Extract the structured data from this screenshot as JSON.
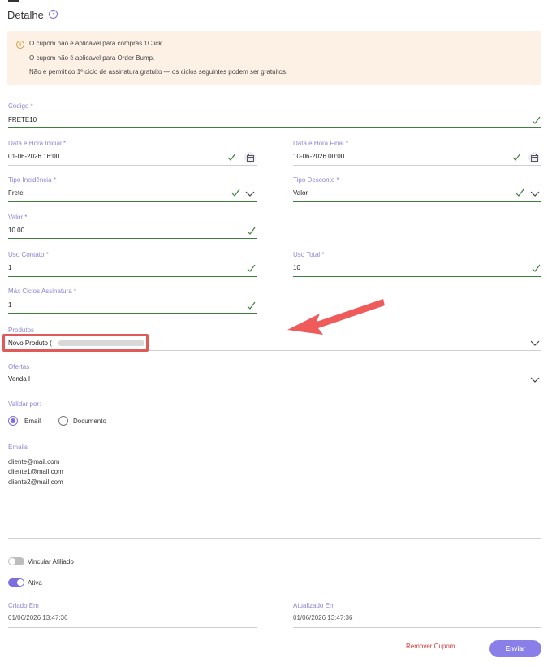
{
  "header": {
    "title": "Detalhe",
    "help_icon": "question-circle-icon"
  },
  "alert": {
    "icon": "warning-circle-icon",
    "lines": [
      "O cupom não é aplicavel para compras 1Click.",
      "O cupom não é aplicavel para Order Bump.",
      "Não é permitido 1º ciclo de assinatura gratuito — os ciclos seguintes podem ser gratuitos."
    ]
  },
  "form": {
    "codigo": {
      "label": "Código *",
      "value": "FRETE10"
    },
    "data_inicial": {
      "label": "Data e Hora Inicial *",
      "value": "01-06-2026 16:00"
    },
    "data_final": {
      "label": "Data e Hora Final *",
      "value": "10-06-2026 00:00"
    },
    "tipo_incidencia": {
      "label": "Tipo Incidência *",
      "value": "Frete"
    },
    "tipo_desconto": {
      "label": "Tipo Desconto *",
      "value": "Valor"
    },
    "valor": {
      "label": "Valor *",
      "value": "10.00"
    },
    "uso_contato": {
      "label": "Uso Contato *",
      "value": "1"
    },
    "uso_total": {
      "label": "Uso Total *",
      "value": "10"
    },
    "max_ciclos": {
      "label": "Máx Ciclos Assinatura *",
      "value": "1"
    },
    "produtos": {
      "label": "Produtos",
      "value": "Novo Produto ("
    },
    "ofertas": {
      "label": "Ofertas",
      "value": "Venda I"
    },
    "validar_por": {
      "label": "Validar por:",
      "options": [
        "Email",
        "Documento"
      ],
      "selected": "Email"
    },
    "emails": {
      "label": "Emails",
      "values": [
        "cliente@mail.com",
        "cliente1@mail.com",
        "cliente2@mail.com"
      ]
    },
    "vincular_afiliado": {
      "label": "Vincular Afiliado",
      "on": false
    },
    "ativa": {
      "label": "Ativa",
      "on": true
    },
    "criado_em": {
      "label": "Criado Em",
      "value": "01/06/2026 13:47:36"
    },
    "atualizado_em": {
      "label": "Atualizado Em",
      "value": "01/06/2026 13:47:36"
    }
  },
  "actions": {
    "remove_label": "Remover Cupom",
    "submit_label": "Enviar"
  },
  "colors": {
    "accent": "#7b6fe0",
    "valid": "#3f7d3f",
    "danger": "#d23a3a",
    "alert_bg": "#fdf1e6",
    "annotation": "#e05a5a"
  }
}
